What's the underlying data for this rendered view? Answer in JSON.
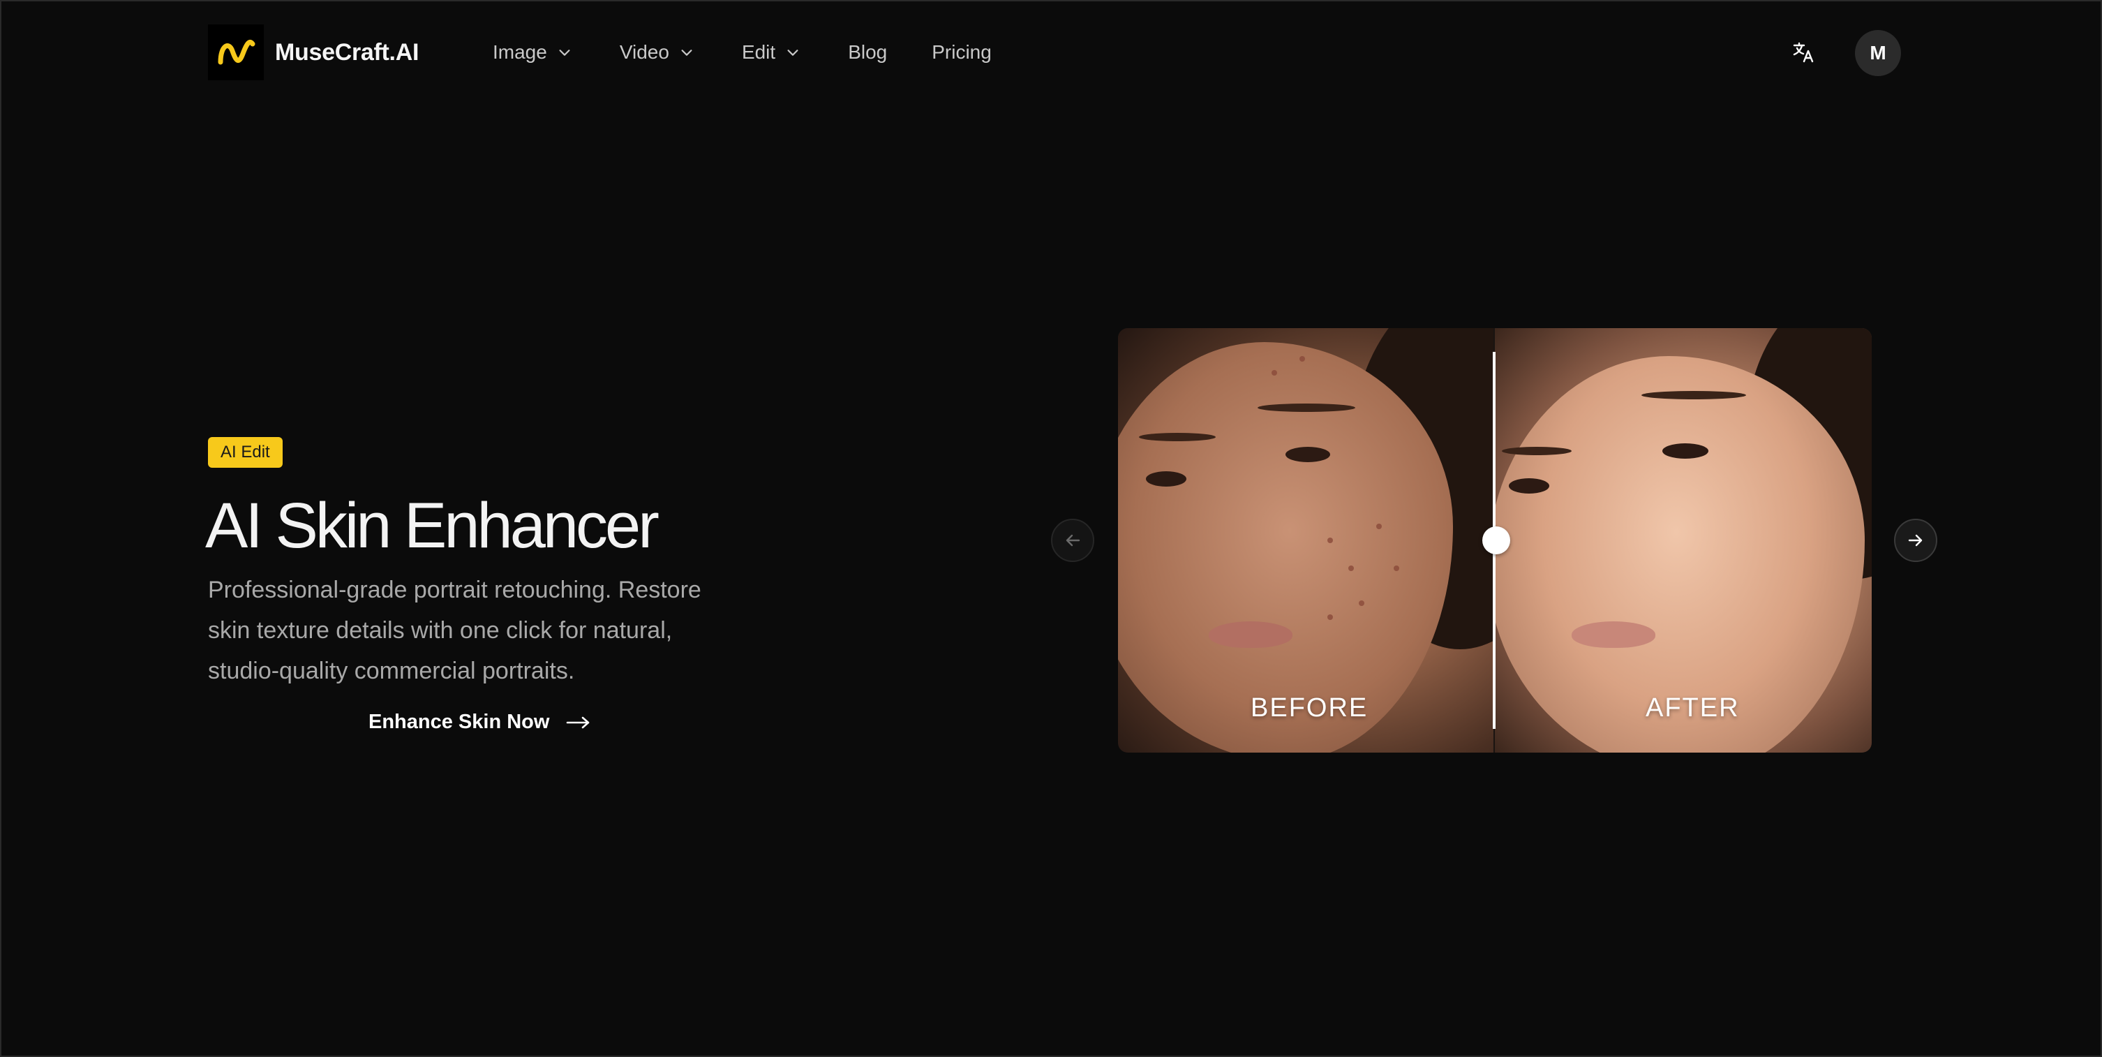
{
  "app": {
    "brand_name": "MuseCraft.AI",
    "brand_color": "#f7c91b",
    "background_color": "#0b0b0b"
  },
  "header": {
    "nav": [
      {
        "label": "Image",
        "has_dropdown": true
      },
      {
        "label": "Video",
        "has_dropdown": true
      },
      {
        "label": "Edit",
        "has_dropdown": true
      },
      {
        "label": "Blog",
        "has_dropdown": false
      },
      {
        "label": "Pricing",
        "has_dropdown": false
      }
    ],
    "translate_icon": "translate-icon",
    "avatar_initial": "M"
  },
  "hero": {
    "badge": "AI Edit",
    "title": "AI Skin Enhancer",
    "description": "Professional-grade portrait retouching. Restore skin texture details with one click for natural, studio-quality commercial portraits.",
    "cta_label": "Enhance Skin Now",
    "cta_icon": "arrow-right-icon"
  },
  "comparison": {
    "before_label": "BEFORE",
    "after_label": "AFTER",
    "slider_position": 0.5,
    "prev_icon": "arrow-left-icon",
    "next_icon": "arrow-right-icon"
  }
}
